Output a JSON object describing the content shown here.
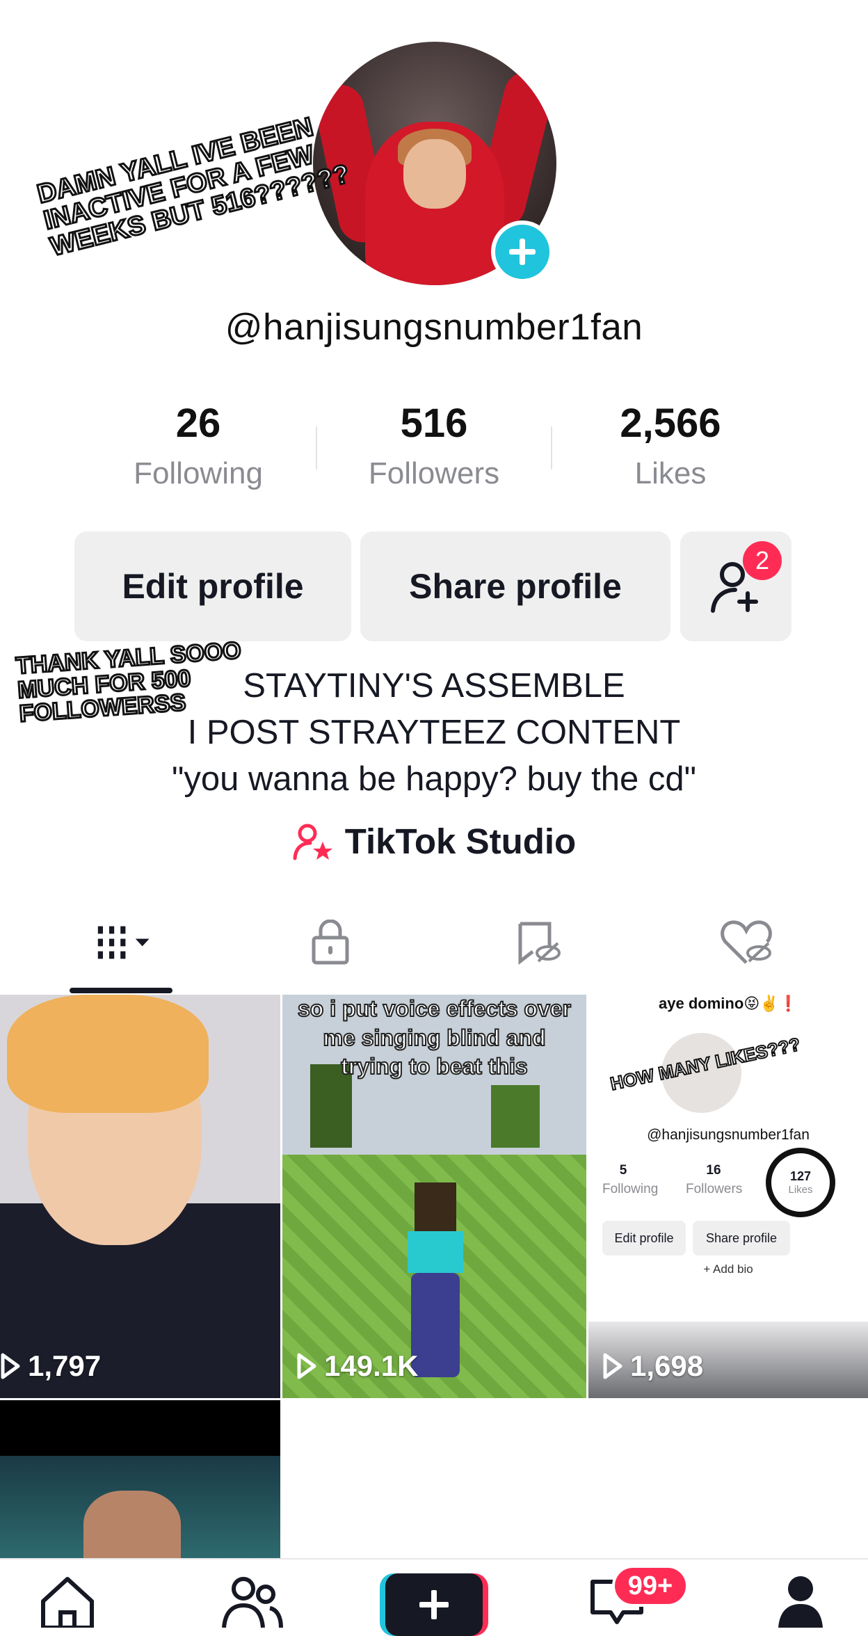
{
  "profile": {
    "username": "@hanjisungsnumber1fan",
    "stats": [
      {
        "value": "26",
        "label": "Following"
      },
      {
        "value": "516",
        "label": "Followers"
      },
      {
        "value": "2,566",
        "label": "Likes"
      }
    ],
    "edit_label": "Edit profile",
    "share_label": "Share profile",
    "friend_request_count": "2",
    "bio_lines": [
      "STAYTINY'S ASSEMBLE",
      "I POST STRAYTEEZ CONTENT",
      "\"you wanna be happy? buy the cd\""
    ],
    "studio_label": "TikTok Studio"
  },
  "stickers": {
    "top": "DAMN YALL IVE BEEN INACTIVE FOR A FEW WEEKS BUT 516??????",
    "middle": "THANK YALL SOOO MUCH FOR 500 FOLLOWERSS",
    "video_three": "HOW MANY LIKES???"
  },
  "tabs": [
    "videos-grid",
    "private",
    "reposts-hidden",
    "liked-hidden"
  ],
  "videos": [
    {
      "views": "1,797"
    },
    {
      "views": "149.1K",
      "caption": "so i put voice effects over me singing blind and trying to beat this"
    },
    {
      "views": "1,698",
      "caption": "aye domino😝✌️❗",
      "inner_username": "@hanjisungsnumber1fan",
      "inner_stats": [
        {
          "value": "5",
          "label": "Following"
        },
        {
          "value": "16",
          "label": "Followers"
        },
        {
          "value": "127",
          "label": "Likes"
        }
      ],
      "inner_edit": "Edit profile",
      "inner_share": "Share profile",
      "inner_bio": "+ Add bio"
    }
  ],
  "nav": {
    "inbox_badge": "99+"
  },
  "colors": {
    "accent_cyan": "#20c4dd",
    "accent_red": "#fe2c55",
    "button_bg": "#efefef",
    "text_gray": "#8a8b91"
  }
}
